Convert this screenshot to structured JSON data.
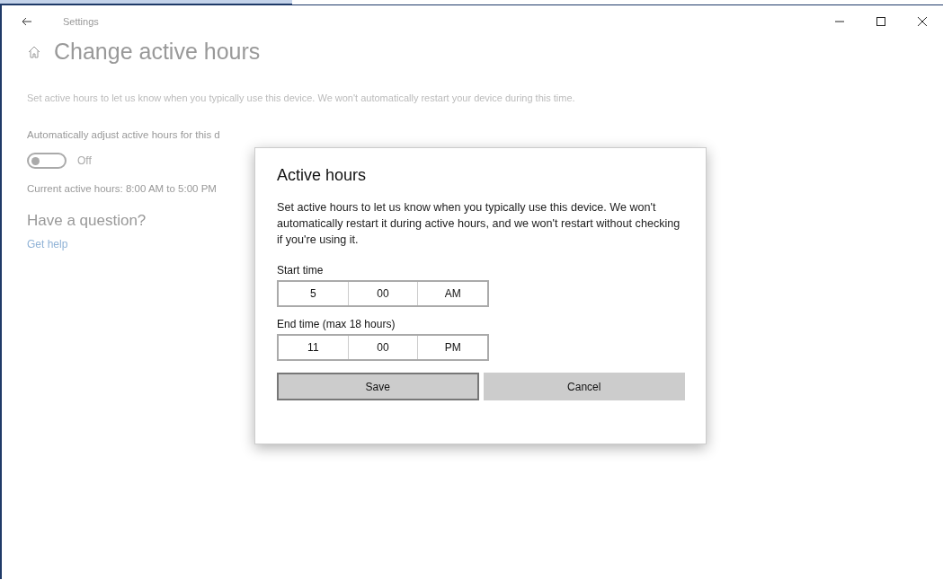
{
  "window": {
    "title": "Settings"
  },
  "page": {
    "title": "Change active hours",
    "description": "Set active hours to let us know when you typically use this device. We won't automatically restart your device during this time.",
    "auto_adjust_label": "Automatically adjust active hours for this d",
    "auto_adjust": {
      "on": false,
      "state_label": "Off"
    },
    "current_hours": "Current active hours: 8:00 AM to 5:00 PM",
    "question_heading": "Have a question?",
    "help_link": "Get help"
  },
  "dialog": {
    "title": "Active hours",
    "body": "Set active hours to let us know when you typically use this device. We won't automatically restart it during active hours, and we won't restart without checking if you're using it.",
    "pickers": [
      {
        "label": "Start time",
        "hour": "5",
        "minute": "00",
        "period": "AM"
      },
      {
        "label": "End time (max 18 hours)",
        "hour": "11",
        "minute": "00",
        "period": "PM"
      }
    ],
    "buttons": [
      {
        "label": "Save",
        "focused": true
      },
      {
        "label": "Cancel",
        "focused": false
      }
    ]
  }
}
